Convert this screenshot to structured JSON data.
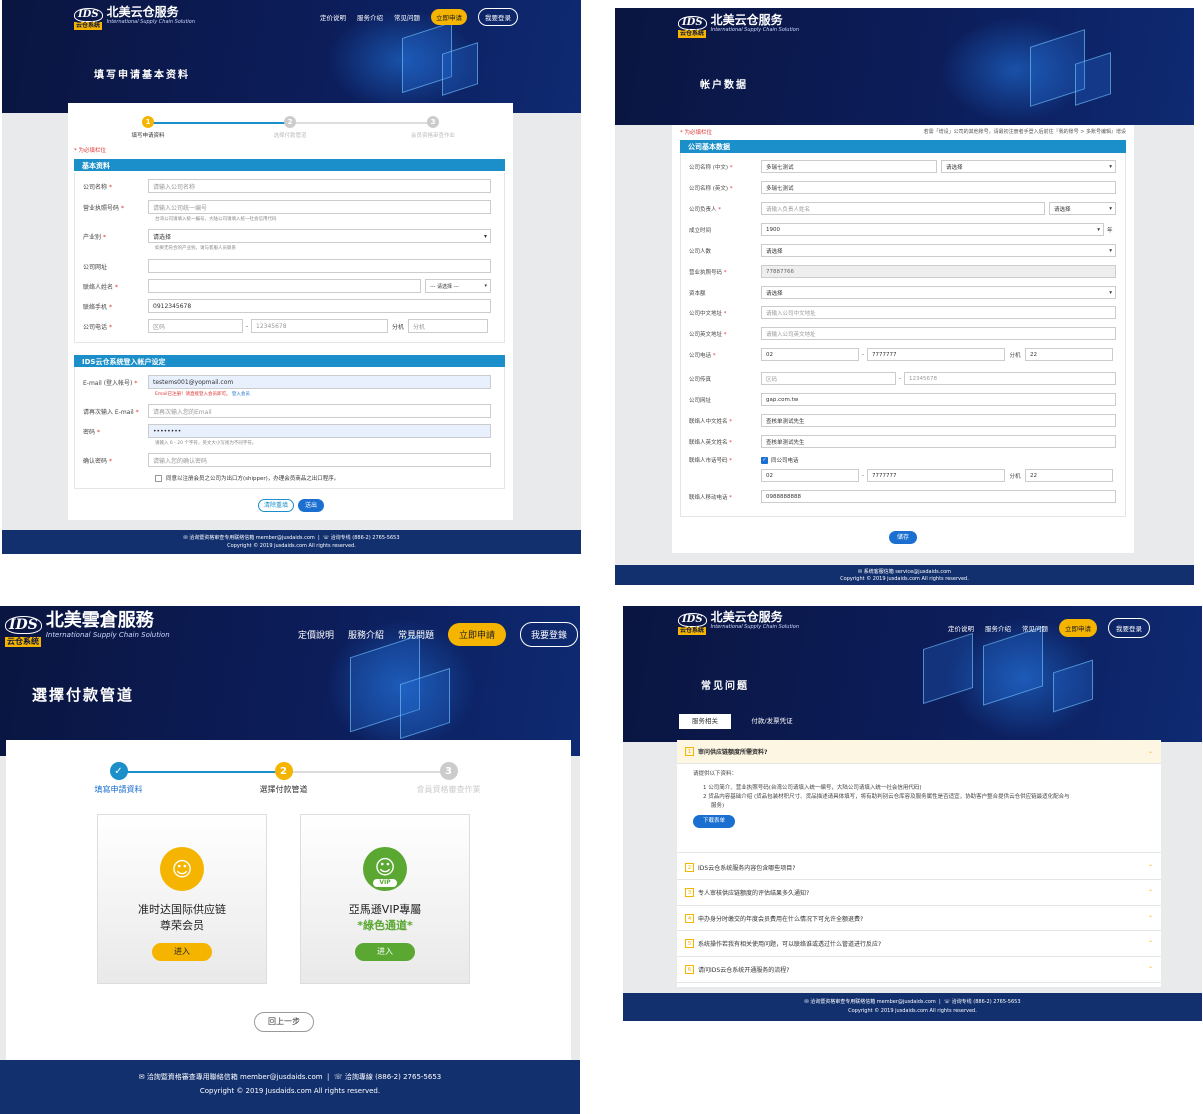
{
  "brand": {
    "name": "北美云仓服务",
    "name_trad": "北美雲倉服務",
    "subtitle": "International Supply Chain Solution",
    "tag": "云仓系统",
    "mark": "IDS"
  },
  "nav": {
    "pricing": "定价说明",
    "services": "服务介绍",
    "faq": "常见问题",
    "apply": "立即申请",
    "login": "我要登录"
  },
  "footer": {
    "email_text": "洽询暨资格审查专用联络信箱 member@jusdaids.com",
    "phone_text": "洽询专线 (886-2) 2765-5653",
    "copyright": "Copyright © 2019 jusdaids.com All rights reserved.",
    "copyright_alt": "Copyright © 2019 Jusdaids.com All rights reserved.",
    "email_alt": "系统客服信箱 service@jusdaids.com"
  },
  "colors": {
    "navy": "#0c1d5a",
    "yellow": "#f5b400",
    "blue": "#1a8fc9",
    "green": "#5aa832",
    "footer": "#13306e"
  },
  "panel1": {
    "title": "填写申请基本资料",
    "steps": [
      {
        "n": "1",
        "label": "填写申请资料"
      },
      {
        "n": "2",
        "label": "选择付款管道"
      },
      {
        "n": "3",
        "label": "会员资格审查作业"
      }
    ],
    "required_note": "* 为必填栏位",
    "section1": "基本资料",
    "company_name": {
      "label": "公司名称",
      "placeholder": "请输入公司名称"
    },
    "license": {
      "label": "营业执照号码",
      "placeholder": "请输入公司统一编号",
      "hint": "台湾公司请填入统一编号，大陆公司请填入统一社会信用代码"
    },
    "industry": {
      "label": "产业别",
      "value": "请选择",
      "hint": "如果无符合的产业别，请与客服人员联系"
    },
    "website": {
      "label": "公司网址"
    },
    "contact": {
      "label": "联络人姓名",
      "title_select": "--- 请选择 ---"
    },
    "mobile": {
      "label": "联络手机",
      "value": "0912345678"
    },
    "phone": {
      "label": "公司电话",
      "area": "区码",
      "number": "12345678",
      "ext_label": "分机",
      "ext": "分机"
    },
    "section2": "IDS云仓系统登入帐户设定",
    "email": {
      "label": "E-mail (登入帐号)",
      "value": "testems001@yopmail.com",
      "error": "Email已注册！请直接登入会员即可。",
      "error_link": "登入会员"
    },
    "email2": {
      "label": "请再次输入 E-mail",
      "placeholder": "请再次输入您的Email"
    },
    "password": {
      "label": "密码",
      "value": "••••••••",
      "hint": "请输入 6 - 20 个字符，英文大小写视为不同字符。"
    },
    "password2": {
      "label": "确认密码",
      "placeholder": "请输入您的确认密码"
    },
    "agree": "同意以注册会员之公司为出口方(shipper)，办理会员商品之出口程序。",
    "reset": "清除重填",
    "submit": "送出"
  },
  "panel2": {
    "title": "帐户数据",
    "required_note": "* 为必填栏位",
    "top_note": "若需「增设」公司的其他账号，请最初注册者手登入后前往『我的账号 > 多账号编辑』增设",
    "section": "公司基本数据",
    "rows": [
      {
        "label": "公司名称 (中文)",
        "req": true,
        "value": "多瑞七测试",
        "extra": "请选择"
      },
      {
        "label": "公司名称 (英文)",
        "req": true,
        "value": "多瑞七测试"
      },
      {
        "label": "公司负责人",
        "req": true,
        "value": "请输入负责人姓名",
        "extra": "请选择"
      },
      {
        "label": "成立时间",
        "req": false,
        "value": "1900",
        "suffix": "年"
      },
      {
        "label": "公司人数",
        "req": false,
        "value": "请选择"
      },
      {
        "label": "营业执照号码",
        "req": true,
        "value": "77887766"
      },
      {
        "label": "资本额",
        "req": false,
        "value": "请选择"
      },
      {
        "label": "公司中文地址",
        "req": true,
        "value": "请输入公司中文地址"
      },
      {
        "label": "公司英文地址",
        "req": true,
        "value": "请输入公司英文地址"
      },
      {
        "label": "公司电话",
        "req": true,
        "value": "02",
        "number": "7777777",
        "ext_label": "分机",
        "ext": "22"
      },
      {
        "label": "公司传真",
        "req": false,
        "value": "区码",
        "number": "12345678"
      },
      {
        "label": "公司网址",
        "req": false,
        "value": "gap.com.tw"
      },
      {
        "label": "联络人中文姓名",
        "req": true,
        "value": "查核单测试先生"
      },
      {
        "label": "联络人英文姓名",
        "req": true,
        "value": "查核单测试先生"
      },
      {
        "label": "联络人市话号码",
        "req": true,
        "check": "同公司电话"
      },
      {
        "label": "",
        "req": false,
        "value": "02",
        "number": "7777777",
        "ext_label": "分机",
        "ext": "22"
      },
      {
        "label": "联络人移动电话",
        "req": true,
        "value": "0988888888"
      }
    ],
    "save": "储存"
  },
  "panel3": {
    "title": "選擇付款管道",
    "steps": [
      {
        "n": "✓",
        "label": "填寫申請資料"
      },
      {
        "n": "2",
        "label": "選擇付款管道"
      },
      {
        "n": "3",
        "label": "會員資格審查作業"
      }
    ],
    "card1": {
      "line1": "准时达国际供应链",
      "line2": "尊荣会员",
      "button": "进入"
    },
    "card2": {
      "line1": "亞馬遜VIP專屬",
      "line2": "*綠色通道*",
      "badge": "VIP",
      "button": "进入"
    },
    "back": "回上一步",
    "nav": {
      "pricing": "定價說明",
      "services": "服務介紹",
      "faq": "常見問題",
      "apply": "立即申請",
      "login": "我要登錄"
    },
    "footer_email": "洽詢暨資格審查專用聯絡信箱 member@jusdaids.com",
    "footer_phone": "洽詢專線 (886-2) 2765-5653"
  },
  "panel4": {
    "title": "常见问题",
    "tabs": [
      "服务相关",
      "付款/发票凭证"
    ],
    "open": {
      "n": "1",
      "q": "审问供应链额度所需资料?",
      "intro": "请提供以下资料：",
      "items": [
        "1  公司简介、营业执照号码(台湾公司请填入统一编号，大陆公司请填入统一社会信用代码)",
        "2  货品内容基础介绍 (货品包装材积尺寸、货品描述请具体填写，将有助判别云仓库容及服务属性是否适宜，协助客户整合提供云仓供应链最适化配合与",
        "服务)"
      ],
      "button": "下载表单"
    },
    "faqs": [
      {
        "n": "2",
        "q": "IDS云仓系统服务内容包含哪些项目?"
      },
      {
        "n": "3",
        "q": "专人审核供应链额度的评估结果多久通知?"
      },
      {
        "n": "4",
        "q": "申办身分时缴交的年度会员费用在什么情况下可允许全额退费?"
      },
      {
        "n": "5",
        "q": "系统操作若我有相关使用问题，可以联络谁或透过什么管道进行反应?"
      },
      {
        "n": "6",
        "q": "请问IDS云仓系统开通服务的流程?"
      }
    ]
  }
}
